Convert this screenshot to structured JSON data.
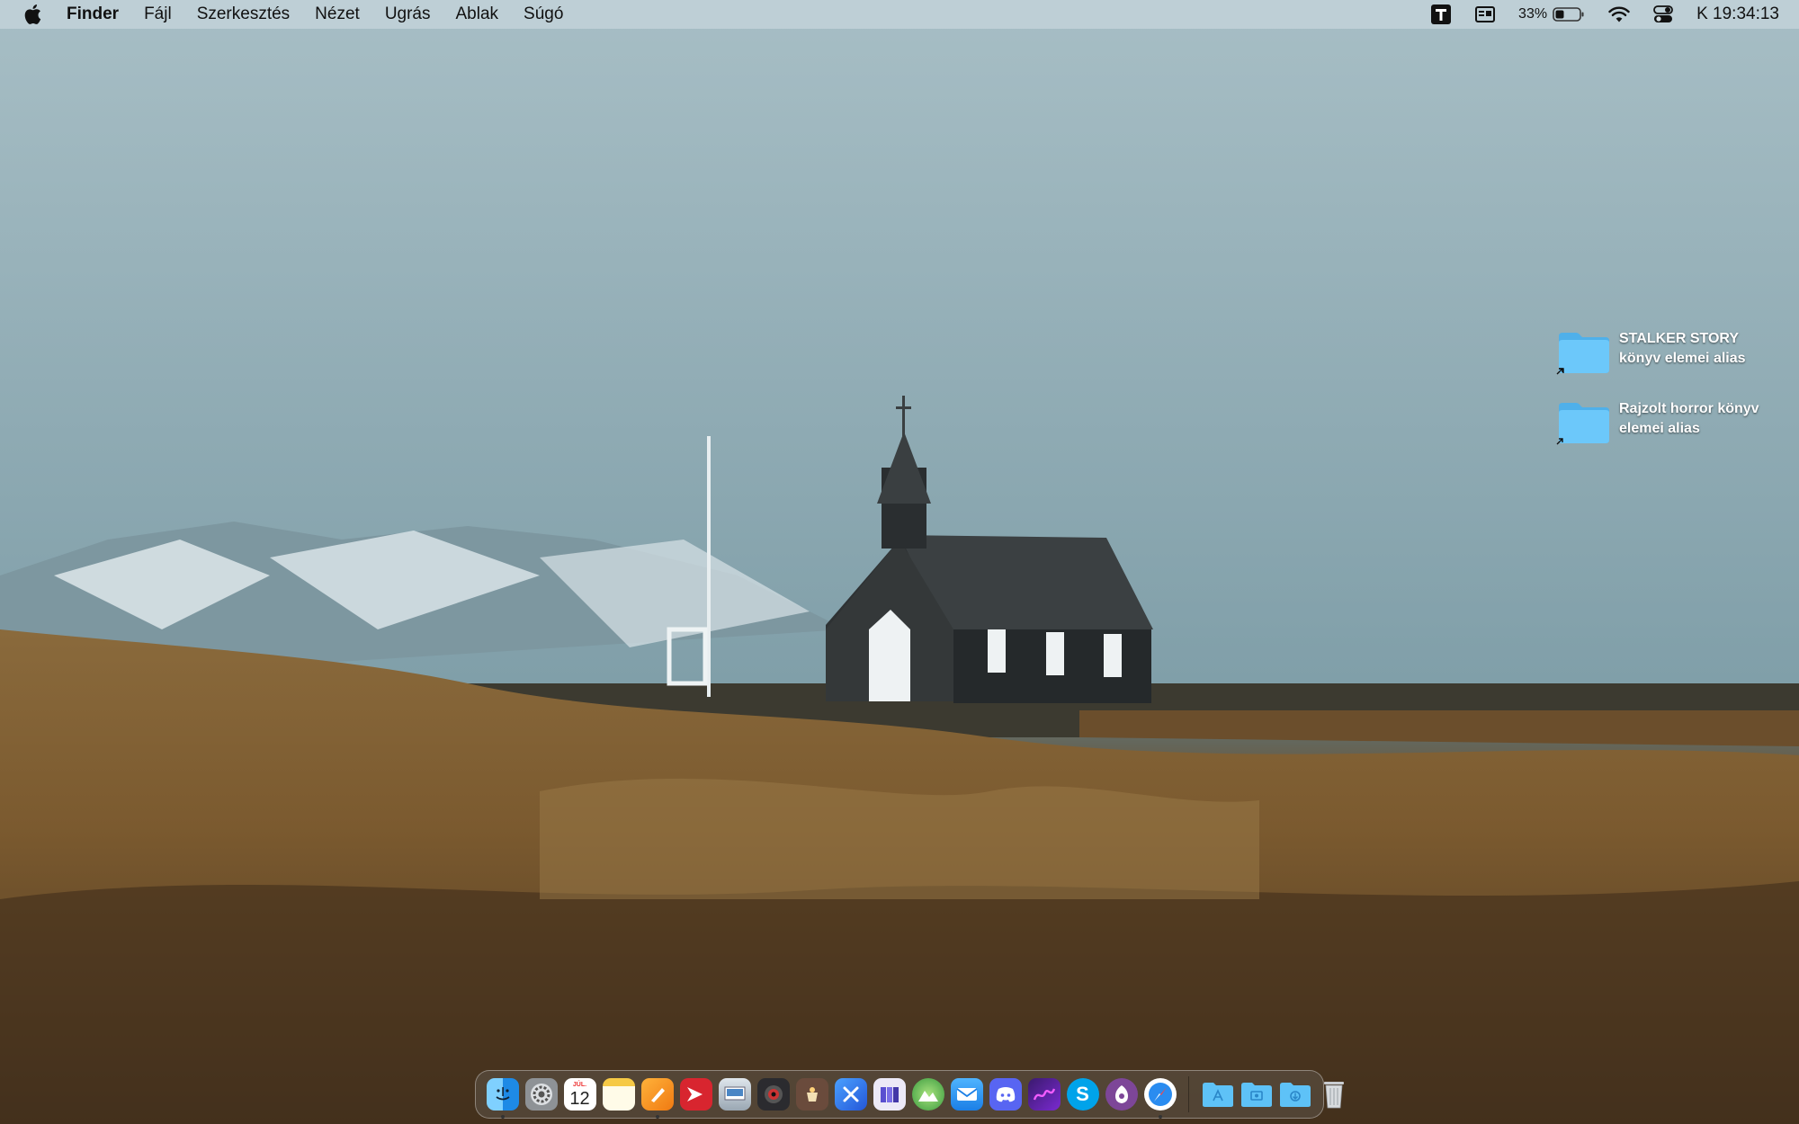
{
  "menubar": {
    "app_name": "Finder",
    "menus": [
      "Fájl",
      "Szerkesztés",
      "Nézet",
      "Ugrás",
      "Ablak",
      "Súgó"
    ],
    "battery_percent": "33%",
    "clock": "K 19:34:13"
  },
  "desktop": {
    "items": [
      {
        "line1": "STALKER STORY",
        "line2": "könyv elemei alias"
      },
      {
        "line1": "Rajzolt horror könyv",
        "line2": "elemei alias"
      }
    ]
  },
  "dock": {
    "calendar_month": "JÚL.",
    "calendar_day": "12",
    "apps": [
      "finder",
      "system-settings",
      "calendar",
      "notes",
      "pages",
      "infuse",
      "preview",
      "photo-booth",
      "lamp",
      "xcode",
      "books-stack",
      "photos-landscape",
      "mail",
      "discord",
      "affinity",
      "skype",
      "tor-browser",
      "safari"
    ],
    "folders": [
      "applications-folder",
      "screenshots-folder",
      "downloads-folder",
      "trash"
    ]
  },
  "colors": {
    "folder_blue": "#5ec2f7",
    "menubar_bg": "#c8d6dc"
  }
}
